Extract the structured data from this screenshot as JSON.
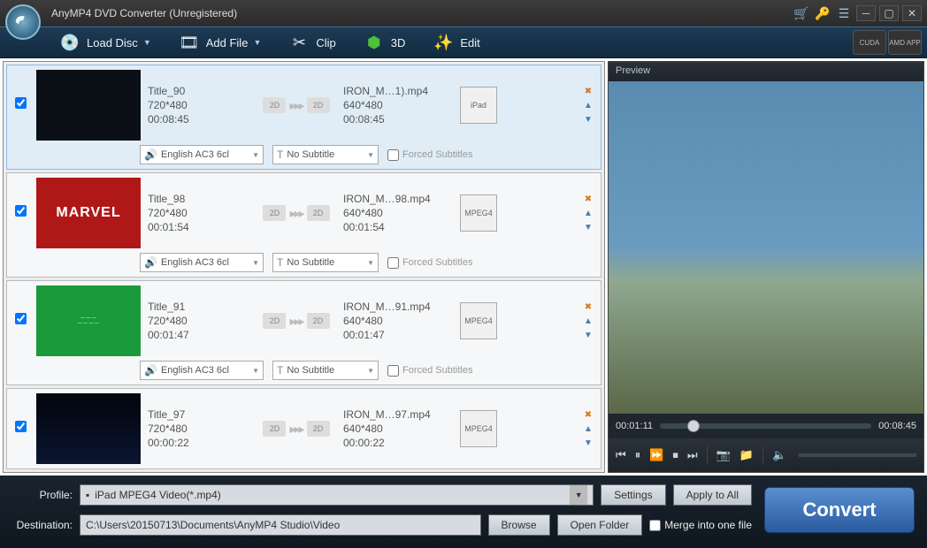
{
  "window": {
    "title": "AnyMP4 DVD Converter (Unregistered)"
  },
  "toolbar": {
    "loadDisc": "Load Disc",
    "addFile": "Add File",
    "clip": "Clip",
    "threeD": "3D",
    "edit": "Edit",
    "cuda": "CUDA",
    "amd": "AMD APP"
  },
  "rows": [
    {
      "title": "Title_90",
      "srcRes": "720*480",
      "srcDur": "00:08:45",
      "outName": "IRON_M…1).mp4",
      "outRes": "640*480",
      "outDur": "00:08:45",
      "device": "iPad",
      "audio": "English AC3 6cl",
      "subtitle": "No Subtitle",
      "forced": "Forced Subtitles",
      "thumbStyle": "dark"
    },
    {
      "title": "Title_98",
      "srcRes": "720*480",
      "srcDur": "00:01:54",
      "outName": "IRON_M…98.mp4",
      "outRes": "640*480",
      "outDur": "00:01:54",
      "device": "MPEG4",
      "audio": "English AC3 6cl",
      "subtitle": "No Subtitle",
      "forced": "Forced Subtitles",
      "thumbStyle": "marvel"
    },
    {
      "title": "Title_91",
      "srcRes": "720*480",
      "srcDur": "00:01:47",
      "outName": "IRON_M…91.mp4",
      "outRes": "640*480",
      "outDur": "00:01:47",
      "device": "MPEG4",
      "audio": "English AC3 6cl",
      "subtitle": "No Subtitle",
      "forced": "Forced Subtitles",
      "thumbStyle": "green"
    },
    {
      "title": "Title_97",
      "srcRes": "720*480",
      "srcDur": "00:00:22",
      "outName": "IRON_M…97.mp4",
      "outRes": "640*480",
      "outDur": "00:00:22",
      "device": "MPEG4",
      "audio": "",
      "subtitle": "",
      "forced": "",
      "thumbStyle": "night"
    }
  ],
  "labels": {
    "box2d": "2D"
  },
  "preview": {
    "title": "Preview",
    "position": "00:01:11",
    "duration": "00:08:45"
  },
  "bottom": {
    "profileLabel": "Profile:",
    "profileValue": "iPad MPEG4 Video(*.mp4)",
    "settings": "Settings",
    "applyAll": "Apply to All",
    "destLabel": "Destination:",
    "destValue": "C:\\Users\\20150713\\Documents\\AnyMP4 Studio\\Video",
    "browse": "Browse",
    "openFolder": "Open Folder",
    "merge": "Merge into one file",
    "convert": "Convert"
  }
}
